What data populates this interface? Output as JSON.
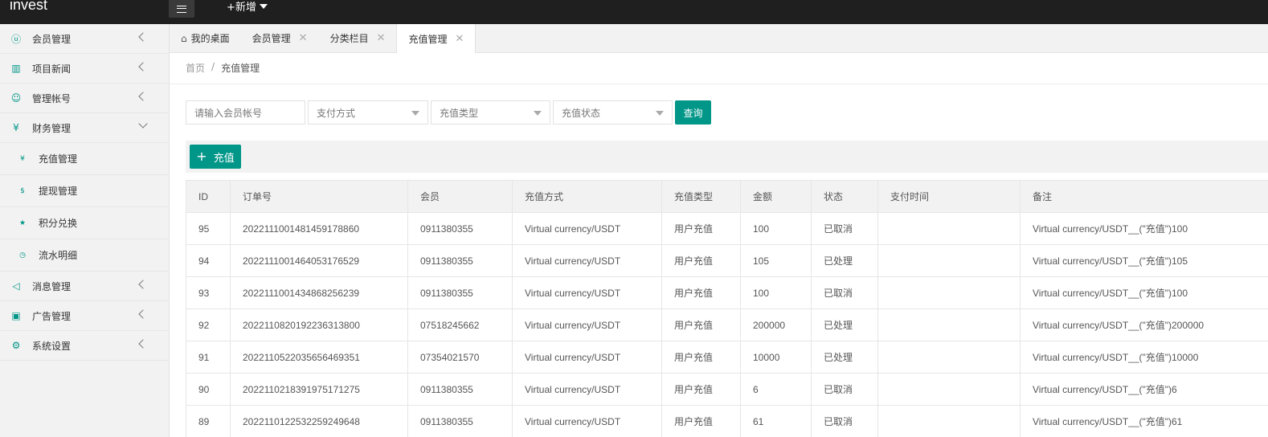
{
  "app": {
    "brand": "invest",
    "add_label": "+新增"
  },
  "sidebar": {
    "items": [
      {
        "label": "会员管理",
        "icon": "user-icon",
        "glyph": "ⓤ"
      },
      {
        "label": "项目新闻",
        "icon": "book-icon",
        "glyph": "▥"
      },
      {
        "label": "管理帐号",
        "icon": "admin-user-icon",
        "glyph": "☺"
      },
      {
        "label": "财务管理",
        "icon": "yen-icon",
        "glyph": "¥"
      },
      {
        "label": "消息管理",
        "icon": "speaker-icon",
        "glyph": "◁"
      },
      {
        "label": "广告管理",
        "icon": "image-icon",
        "glyph": "▣"
      },
      {
        "label": "系统设置",
        "icon": "gear-icon",
        "glyph": "⚙"
      }
    ],
    "finance_sub": [
      {
        "label": "充值管理",
        "icon": "yen-circle-icon",
        "glyph": "¥"
      },
      {
        "label": "提现管理",
        "icon": "dollar-circle-icon",
        "glyph": "$"
      },
      {
        "label": "积分兑换",
        "icon": "star-icon",
        "glyph": "★"
      },
      {
        "label": "流水明细",
        "icon": "clock-icon",
        "glyph": "◷"
      }
    ]
  },
  "tabs": [
    {
      "label": "我的桌面"
    },
    {
      "label": "会员管理"
    },
    {
      "label": "分类栏目"
    },
    {
      "label": "充值管理"
    }
  ],
  "breadcrumb": {
    "home": "首页",
    "separator": "/",
    "current": "充值管理"
  },
  "filters": {
    "account_placeholder": "请输入会员帐号",
    "pay_method": "支付方式",
    "recharge_type": "充值类型",
    "recharge_status": "充值状态",
    "search_label": "查询"
  },
  "toolbar": {
    "add_label": "充值"
  },
  "table": {
    "headers": [
      "ID",
      "订单号",
      "会员",
      "充值方式",
      "充值类型",
      "金额",
      "状态",
      "支付时间",
      "备注"
    ],
    "rows": [
      [
        "95",
        "2022111001481459178860",
        "0911380355",
        "Virtual currency/USDT",
        "用户充值",
        "100",
        "已取消",
        "",
        "Virtual currency/USDT__(\"充值\")100"
      ],
      [
        "94",
        "2022111001464053176529",
        "0911380355",
        "Virtual currency/USDT",
        "用户充值",
        "105",
        "已处理",
        "",
        "Virtual currency/USDT__(\"充值\")105"
      ],
      [
        "93",
        "2022111001434868256239",
        "0911380355",
        "Virtual currency/USDT",
        "用户充值",
        "100",
        "已取消",
        "",
        "Virtual currency/USDT__(\"充值\")100"
      ],
      [
        "92",
        "2022110820192236313800",
        "07518245662",
        "Virtual currency/USDT",
        "用户充值",
        "200000",
        "已处理",
        "",
        "Virtual currency/USDT__(\"充值\")200000"
      ],
      [
        "91",
        "2022110522035656469351",
        "07354021570",
        "Virtual currency/USDT",
        "用户充值",
        "10000",
        "已处理",
        "",
        "Virtual currency/USDT__(\"充值\")10000"
      ],
      [
        "90",
        "2022110218391975171275",
        "0911380355",
        "Virtual currency/USDT",
        "用户充值",
        "6",
        "已取消",
        "",
        "Virtual currency/USDT__(\"充值\")6"
      ],
      [
        "89",
        "2022110122532259249648",
        "0911380355",
        "Virtual currency/USDT",
        "用户充值",
        "61",
        "已取消",
        "",
        "Virtual currency/USDT__(\"充值\")61"
      ]
    ]
  },
  "colors": {
    "accent": "#009688",
    "topbar": "#1f1f1f",
    "sidebar_bg": "#f2f2f2"
  }
}
